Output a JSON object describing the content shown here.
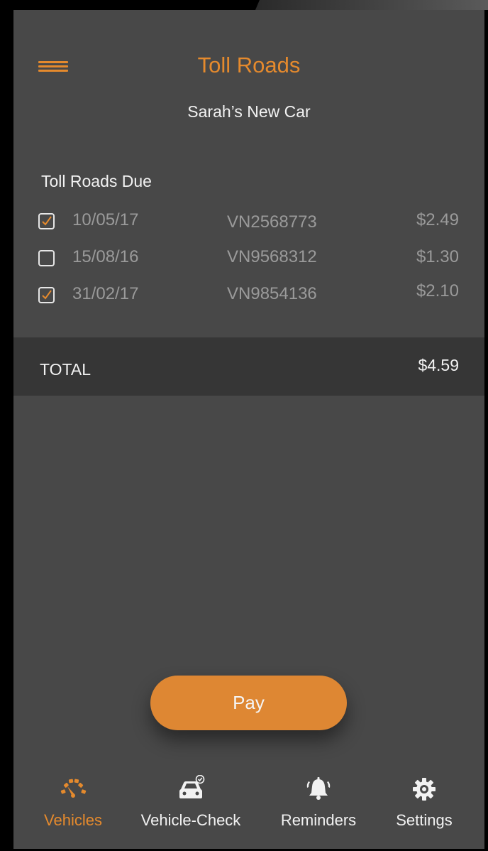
{
  "header": {
    "title": "Toll Roads",
    "subtitle": "Sarah’s New Car",
    "menu_icon": "hamburger-menu-icon"
  },
  "tolls": {
    "section_title": "Toll Roads Due",
    "rows": [
      {
        "date": "10/05/17",
        "ref": "VN2568773",
        "amount": "$2.49",
        "checked": true
      },
      {
        "date": "15/08/16",
        "ref": "VN9568312",
        "amount": "$1.30",
        "checked": false
      },
      {
        "date": "31/02/17",
        "ref": "VN9854136",
        "amount": "$2.10",
        "checked": true
      }
    ]
  },
  "total": {
    "label": "TOTAL",
    "value": "$4.59"
  },
  "pay_label": "Pay",
  "tabs": [
    {
      "label": "Vehicles",
      "icon": "speedometer-icon",
      "active": true
    },
    {
      "label": "Vehicle-Check",
      "icon": "car-check-icon",
      "active": false
    },
    {
      "label": "Reminders",
      "icon": "alarm-bell-icon",
      "active": false
    },
    {
      "label": "Settings",
      "icon": "gear-icon",
      "active": false
    }
  ],
  "colors": {
    "accent": "#e58a2d",
    "background": "#484848",
    "total_bar": "#363636",
    "muted_text": "#9a9a9a"
  }
}
